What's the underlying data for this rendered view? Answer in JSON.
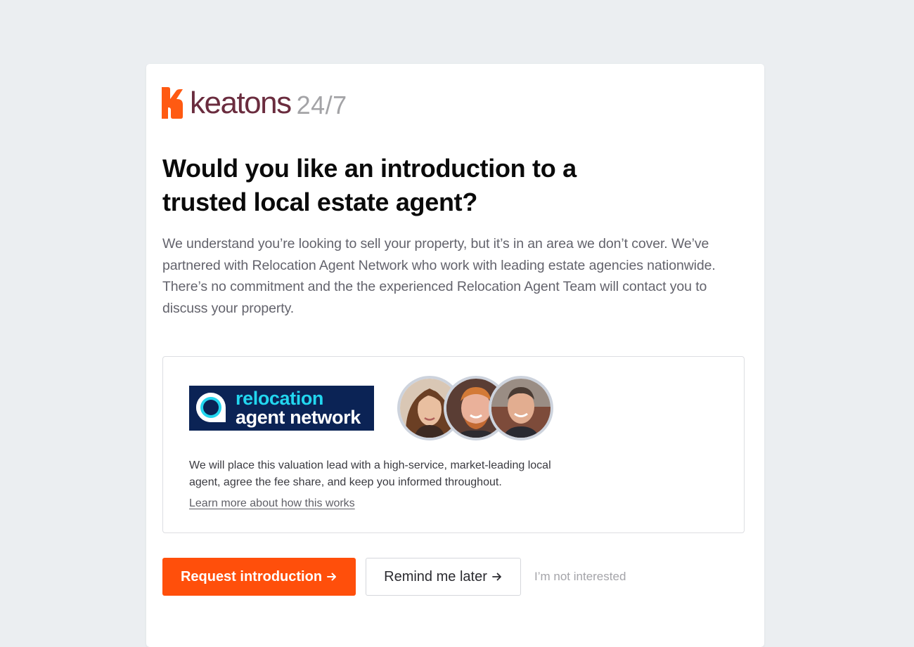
{
  "brand": {
    "name": "keatons",
    "suffix": "24/7",
    "mark_color": "#ff5a12",
    "name_color": "#6a2c3e"
  },
  "headline": "Would you like an introduction to a trusted local estate agent?",
  "intro": "We understand you’re looking to sell your property, but it’s in an area we don’t cover. We’ve partnered with Relocation Agent Network who work with leading estate agencies nationwide. There’s no commitment and the the experienced Relocation Agent Team will contact you to discuss your property.",
  "partner": {
    "logo_line1": "relocation",
    "logo_line2": "agent network",
    "logo_colors": {
      "background": "#0b2355",
      "accent": "#22d6ef",
      "text": "#ffffff"
    },
    "description": "We will place this valuation lead with a high-service, market-leading local agent, agree the fee share, and keep you informed throughout.",
    "learn_more": "Learn more about how this works"
  },
  "actions": {
    "primary_label": "Request introduction",
    "secondary_label": "Remind me later",
    "tertiary_label": "I’m not interested",
    "primary_color": "#ff4f0b",
    "arrow_icon": "arrow-right-icon"
  }
}
